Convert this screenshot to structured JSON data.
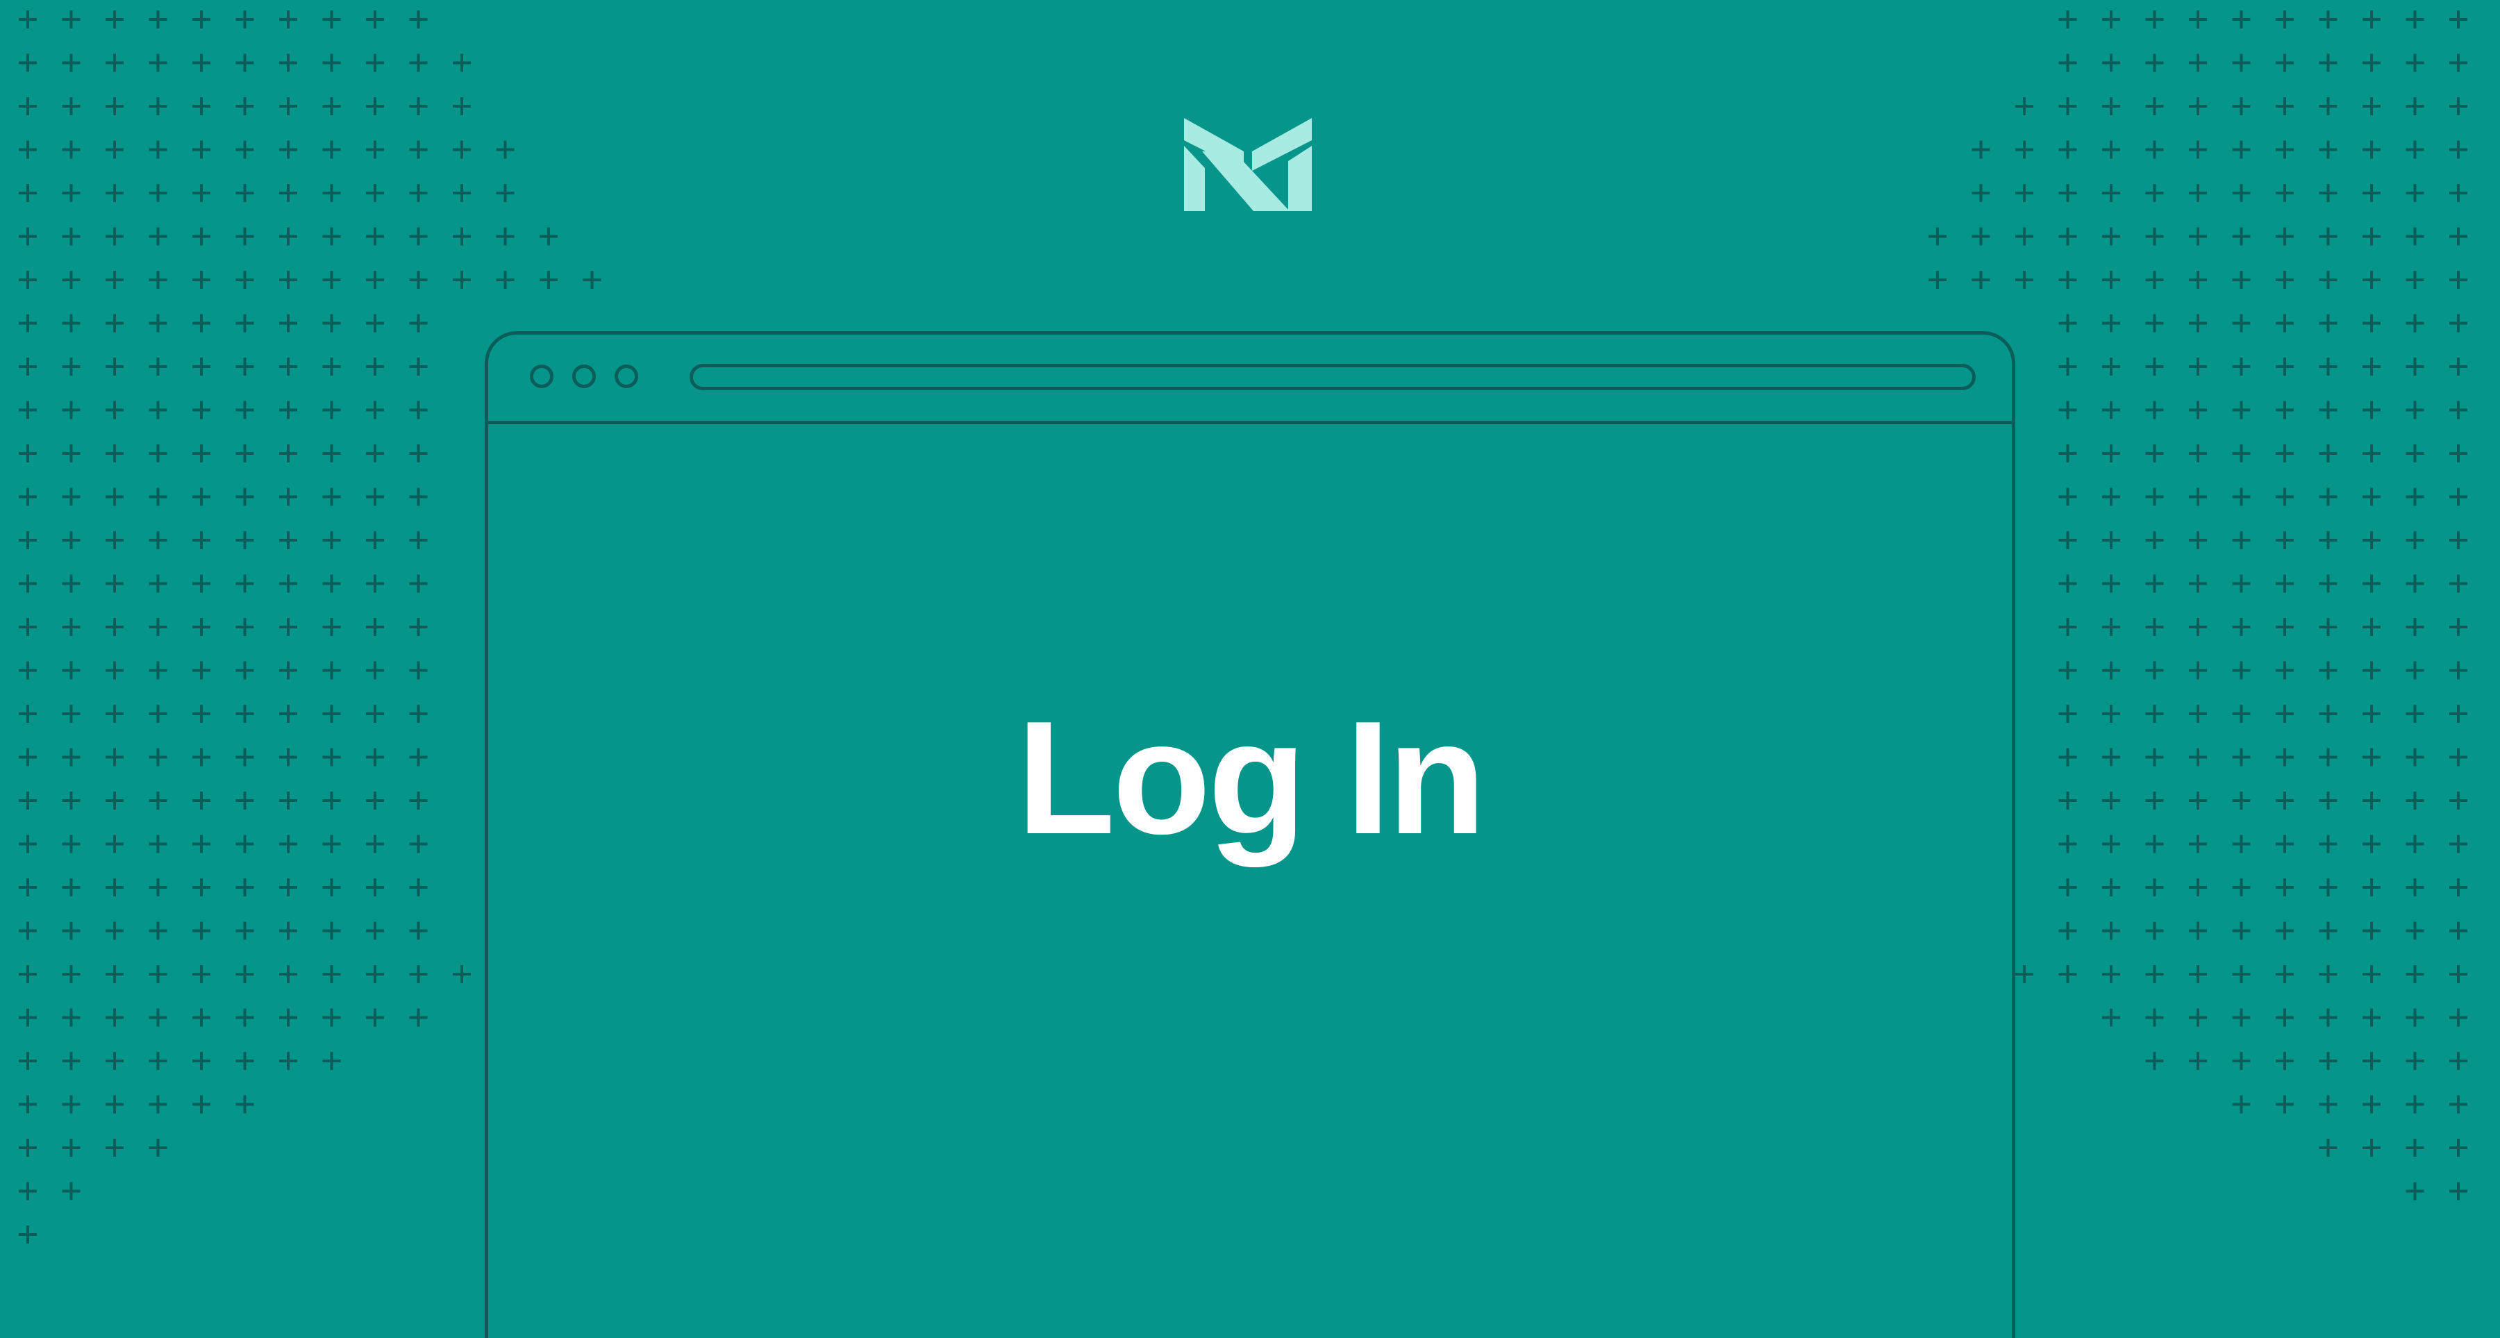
{
  "page": {
    "title": "Log In",
    "background_color": "#05958b",
    "accent_color": "#a7ebe3",
    "line_color": "#0a5d58"
  },
  "logo": {
    "icon": "m-logo-icon"
  },
  "browser": {
    "window_dots": [
      "window-dot-icon",
      "window-dot-icon",
      "window-dot-icon"
    ],
    "address_bar": {
      "value": ""
    }
  }
}
